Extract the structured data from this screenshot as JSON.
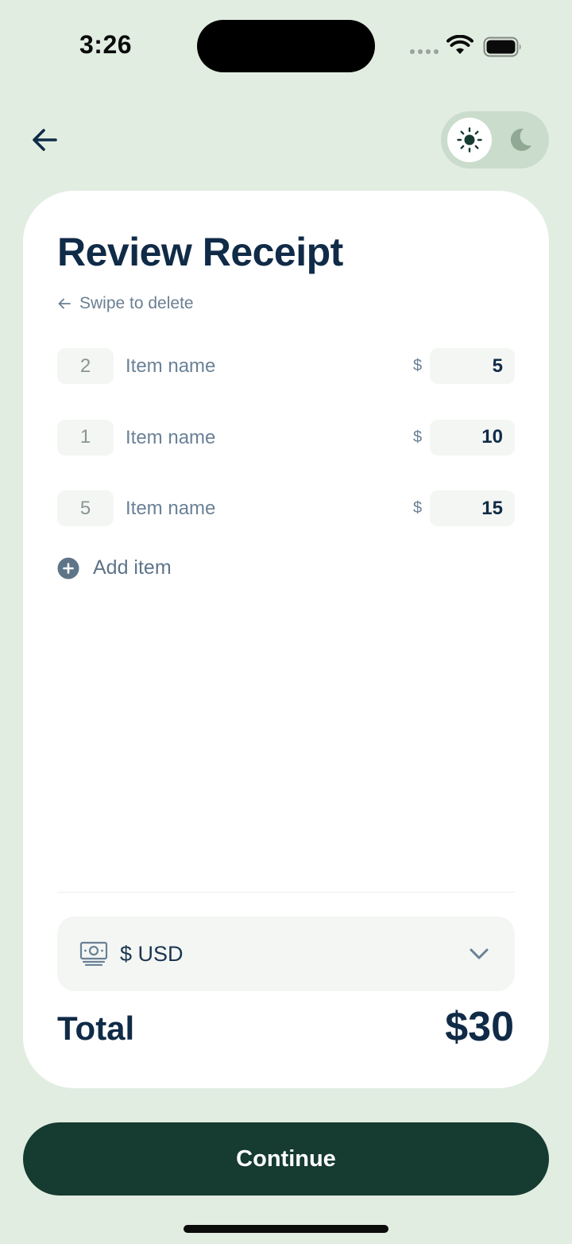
{
  "status_bar": {
    "time": "3:26",
    "icons": [
      "signal-dots-icon",
      "wifi-icon",
      "battery-icon"
    ]
  },
  "header": {
    "back_icon": "arrow-left-icon",
    "theme_toggle": {
      "selected": "light",
      "options": [
        "sun-icon",
        "moon-icon"
      ]
    }
  },
  "card": {
    "title": "Review Receipt",
    "hint": "Swipe to delete",
    "items": [
      {
        "qty": "2",
        "name": "Item name",
        "currency_sign": "$",
        "price": "5"
      },
      {
        "qty": "1",
        "name": "Item name",
        "currency_sign": "$",
        "price": "10"
      },
      {
        "qty": "5",
        "name": "Item name",
        "currency_sign": "$",
        "price": "15"
      }
    ],
    "add_item_label": "Add item",
    "currency": {
      "value": "$ USD",
      "icon": "money-icon"
    },
    "total_label": "Total",
    "total_value": "$30"
  },
  "footer": {
    "continue_label": "Continue"
  },
  "colors": {
    "background": "#e2ede1",
    "card": "#ffffff",
    "primary_button": "#163b30",
    "title_text": "#102b47",
    "muted_text": "#6a8196",
    "field_bg": "#f3f6f3"
  }
}
